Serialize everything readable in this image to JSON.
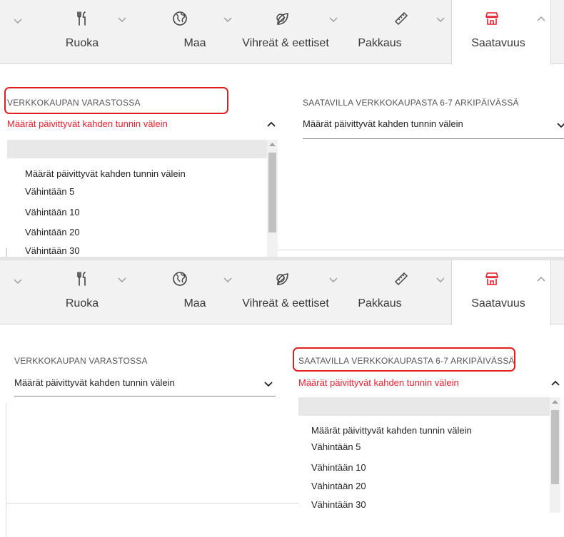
{
  "tabs": [
    {
      "label": "Ruoka",
      "icon": "utensils-icon"
    },
    {
      "label": "Maa",
      "icon": "globe-icon"
    },
    {
      "label": "Vihreät & eettiset",
      "icon": "leaf-icon"
    },
    {
      "label": "Pakkaus",
      "icon": "ruler-icon"
    },
    {
      "label": "Saatavuus",
      "icon": "store-icon",
      "active": true
    }
  ],
  "fields": {
    "web_stock": {
      "title": "VERKKOKAUPAN VARASTOSSA",
      "value": "Määrät päivittyvät kahden tunnin välein"
    },
    "web_available": {
      "title": "SAATAVILLA VERKKOKAUPASTA 6-7 ARKIPÄIVÄSSÄ",
      "value": "Määrät päivittyvät kahden tunnin välein"
    }
  },
  "dropdown_options": [
    "Määrät päivittyvät kahden tunnin välein",
    "Vähintään 5",
    "Vähintään 10",
    "Vähintään 20",
    "Vähintään 30"
  ],
  "colors": {
    "accent_red": "#e8202e",
    "highlight_border": "#e02020",
    "tab_bar_bg": "#f2f2f2",
    "icon_dark": "#444444"
  }
}
